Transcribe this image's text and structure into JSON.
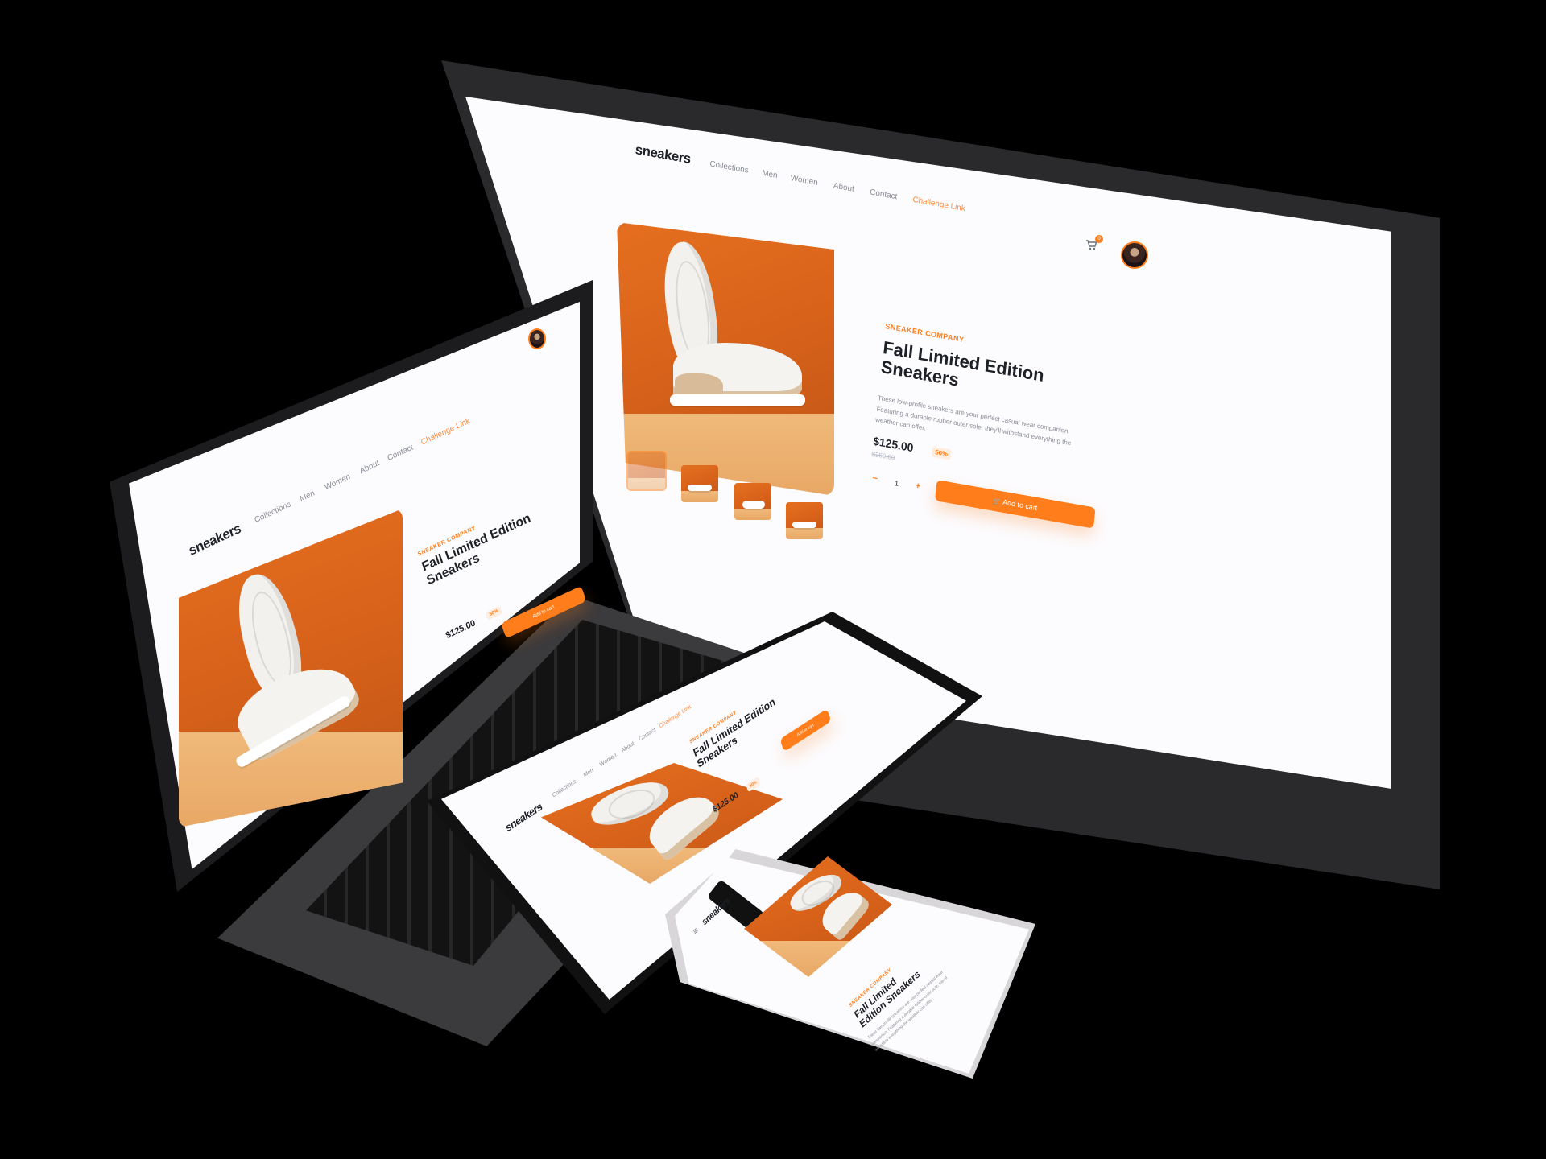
{
  "brand": "sneakers",
  "nav": {
    "items": [
      "Collections",
      "Men",
      "Women",
      "About",
      "Contact"
    ],
    "challenge_link": "Challenge Link"
  },
  "cart": {
    "count": "0",
    "icon": "cart-icon"
  },
  "product": {
    "company": "SNEAKER COMPANY",
    "title": "Fall Limited Edition Sneakers",
    "description": "These low-profile sneakers are your perfect casual wear companion. Featuring a durable rubber outer sole, they'll withstand everything the weather can offer.",
    "price": "$125.00",
    "discount": "50%",
    "old_price": "$250.00",
    "quantity": "1",
    "minus": "−",
    "plus": "+",
    "add_to_cart": "Add to cart"
  },
  "colors": {
    "accent": "#ff7e1b",
    "dark": "#1d2026",
    "muted": "#8a8d97"
  }
}
